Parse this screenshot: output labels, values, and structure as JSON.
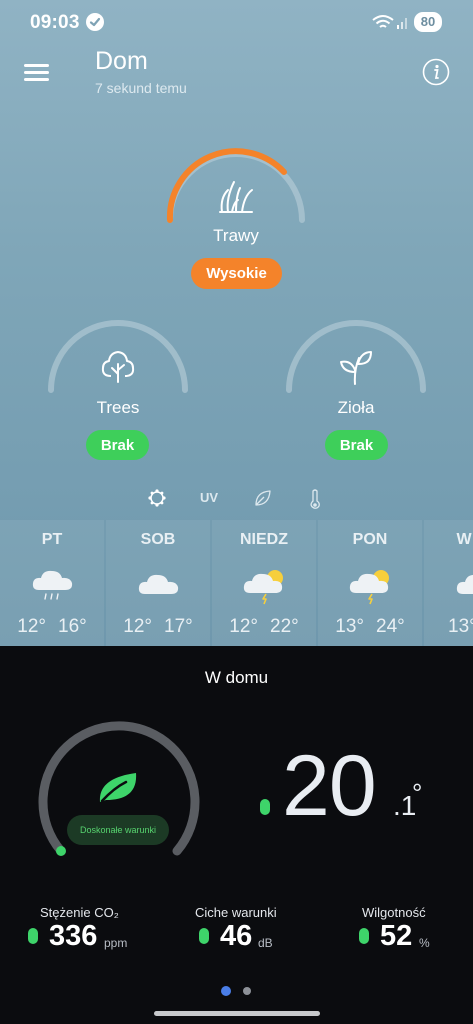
{
  "status": {
    "time": "09:03",
    "battery": "80"
  },
  "header": {
    "title": "Dom",
    "subtitle": "7 sekund temu"
  },
  "pollen": {
    "main": {
      "label": "Trawy",
      "level": "Wysokie",
      "level_color": "#f4832a",
      "fill": 0.75
    },
    "secondary": [
      {
        "label": "Trees",
        "level": "Brak",
        "level_color": "#3ecf5a",
        "fill": 0
      },
      {
        "label": "Zioła",
        "level": "Brak",
        "level_color": "#3ecf5a",
        "fill": 0
      }
    ]
  },
  "filters": [
    {
      "name": "pollen-filter-icon",
      "text": ""
    },
    {
      "name": "uv-filter",
      "text": "UV"
    },
    {
      "name": "leaf-filter-icon",
      "text": ""
    },
    {
      "name": "thermometer-filter-icon",
      "text": ""
    }
  ],
  "forecast": [
    {
      "day": "PT",
      "low": "12°",
      "high": "16°",
      "icon": "rain-cloud-icon"
    },
    {
      "day": "SOB",
      "low": "12°",
      "high": "17°",
      "icon": "cloud-icon"
    },
    {
      "day": "NIEDZ",
      "low": "12°",
      "high": "22°",
      "icon": "storm-sun-icon"
    },
    {
      "day": "PON",
      "low": "13°",
      "high": "24°",
      "icon": "storm-sun-icon"
    },
    {
      "day": "W",
      "low": "13°",
      "high": "",
      "icon": "cloud-icon"
    }
  ],
  "indoor": {
    "title": "W domu",
    "gauge_label": "Doskonałe warunki",
    "temp_int": "20",
    "temp_dec": ".1",
    "temp_unit": "°",
    "stats": [
      {
        "label": "Stężenie CO₂",
        "value": "336",
        "unit": "ppm"
      },
      {
        "label": "Ciche warunki",
        "value": "46",
        "unit": "dB"
      },
      {
        "label": "Wilgotność",
        "value": "52",
        "unit": "%"
      }
    ]
  },
  "pager": {
    "count": 2,
    "active": 0
  }
}
